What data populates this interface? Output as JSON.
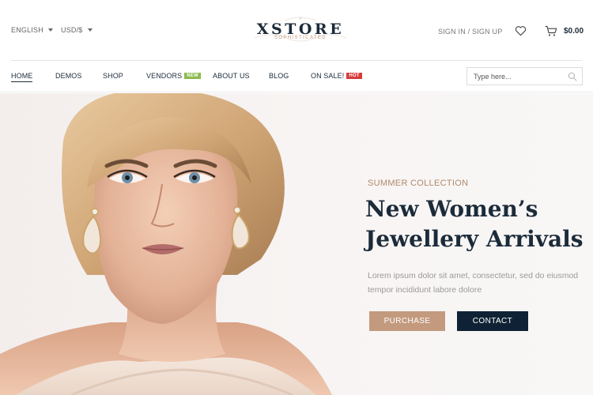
{
  "topbar": {
    "language": "ENGLISH",
    "currency": "USD/$",
    "auth_link": "SIGN IN / SIGN UP",
    "cart_total": "$0.00"
  },
  "logo": {
    "title": "XSTORE",
    "subtitle": "SOPHISTICATED"
  },
  "nav": {
    "items": [
      {
        "label": "HOME",
        "active": true
      },
      {
        "label": "DEMOS"
      },
      {
        "label": "SHOP"
      },
      {
        "label": "VENDORS",
        "badge": "NEW"
      },
      {
        "label": "ABOUT US"
      },
      {
        "label": "BLOG"
      },
      {
        "label": "ON SALE!",
        "badge": "HOT"
      }
    ],
    "search_placeholder": "Type here..."
  },
  "hero": {
    "kicker": "SUMMER COLLECTION",
    "title": "New Women’s Jewellery Arrivals",
    "description": "Lorem ipsum dolor sit amet, consectetur, sed do eiusmod tempor incididunt labore dolore",
    "purchase_label": "PURCHASE",
    "contact_label": "CONTACT"
  },
  "colors": {
    "brand_navy": "#0f2235",
    "accent_tan": "#c39a7e",
    "badge_new": "#8bbb4f",
    "badge_hot": "#d63b3b"
  },
  "icons": [
    "chevron-down-icon",
    "heart-icon",
    "cart-icon",
    "search-icon"
  ]
}
